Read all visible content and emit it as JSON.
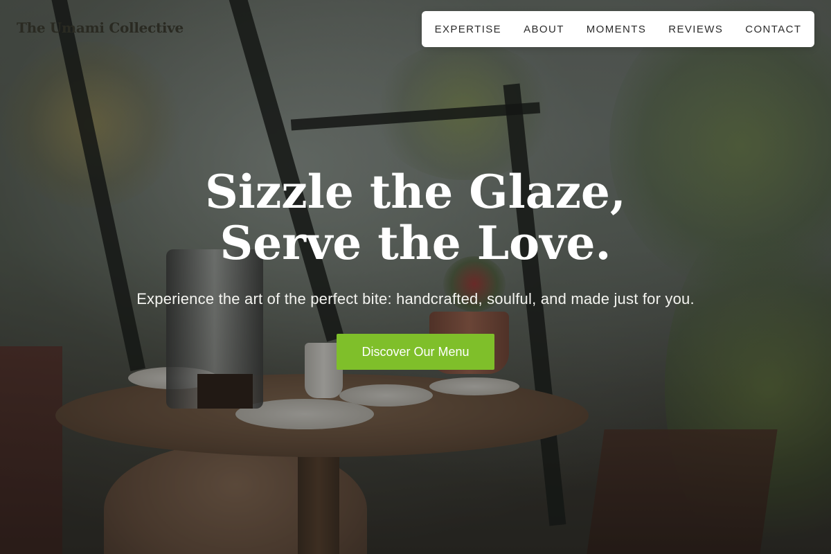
{
  "brand": {
    "name": "The Umami Collective"
  },
  "nav": {
    "items": [
      {
        "label": "EXPERTISE"
      },
      {
        "label": "ABOUT"
      },
      {
        "label": "MOMENTS"
      },
      {
        "label": "REVIEWS"
      },
      {
        "label": "CONTACT"
      }
    ]
  },
  "hero": {
    "headline": "Sizzle the Glaze, Serve the Love.",
    "subheadline": "Experience the art of the perfect bite: handcrafted, soulful, and made just for you.",
    "cta_label": "Discover Our Menu"
  },
  "colors": {
    "accent": "#7fbf2a",
    "nav_background": "#ffffff",
    "headline": "#ffffff"
  }
}
